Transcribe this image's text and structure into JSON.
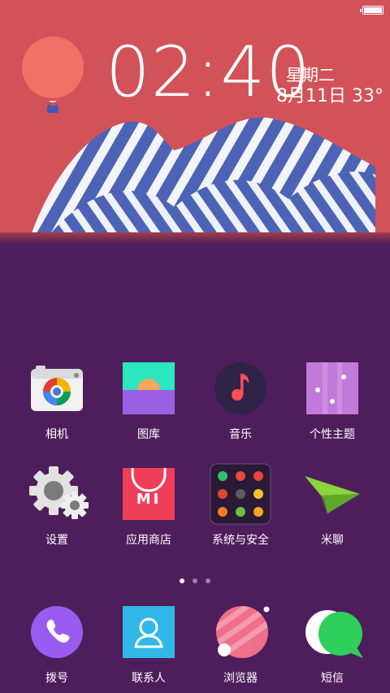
{
  "status_bar": {
    "battery_level": 1.0
  },
  "widget": {
    "time": "02:40",
    "weekday": "星期二",
    "date_temp": "8月11日 33°"
  },
  "apps_row1": [
    {
      "label": "相机",
      "icon": "camera-icon"
    },
    {
      "label": "图库",
      "icon": "gallery-icon"
    },
    {
      "label": "音乐",
      "icon": "music-icon"
    },
    {
      "label": "个性主题",
      "icon": "themes-icon"
    }
  ],
  "apps_row2": [
    {
      "label": "设置",
      "icon": "gear-icon"
    },
    {
      "label": "应用商店",
      "icon": "app-store-icon"
    },
    {
      "label": "系统与安全",
      "icon": "folder-icon"
    },
    {
      "label": "米聊",
      "icon": "paper-plane-icon"
    }
  ],
  "page_indicator": {
    "pages": 3,
    "current": 1
  },
  "dock": [
    {
      "label": "拨号",
      "icon": "phone-icon"
    },
    {
      "label": "联系人",
      "icon": "contacts-icon"
    },
    {
      "label": "浏览器",
      "icon": "browser-icon"
    },
    {
      "label": "短信",
      "icon": "messages-icon"
    }
  ]
}
